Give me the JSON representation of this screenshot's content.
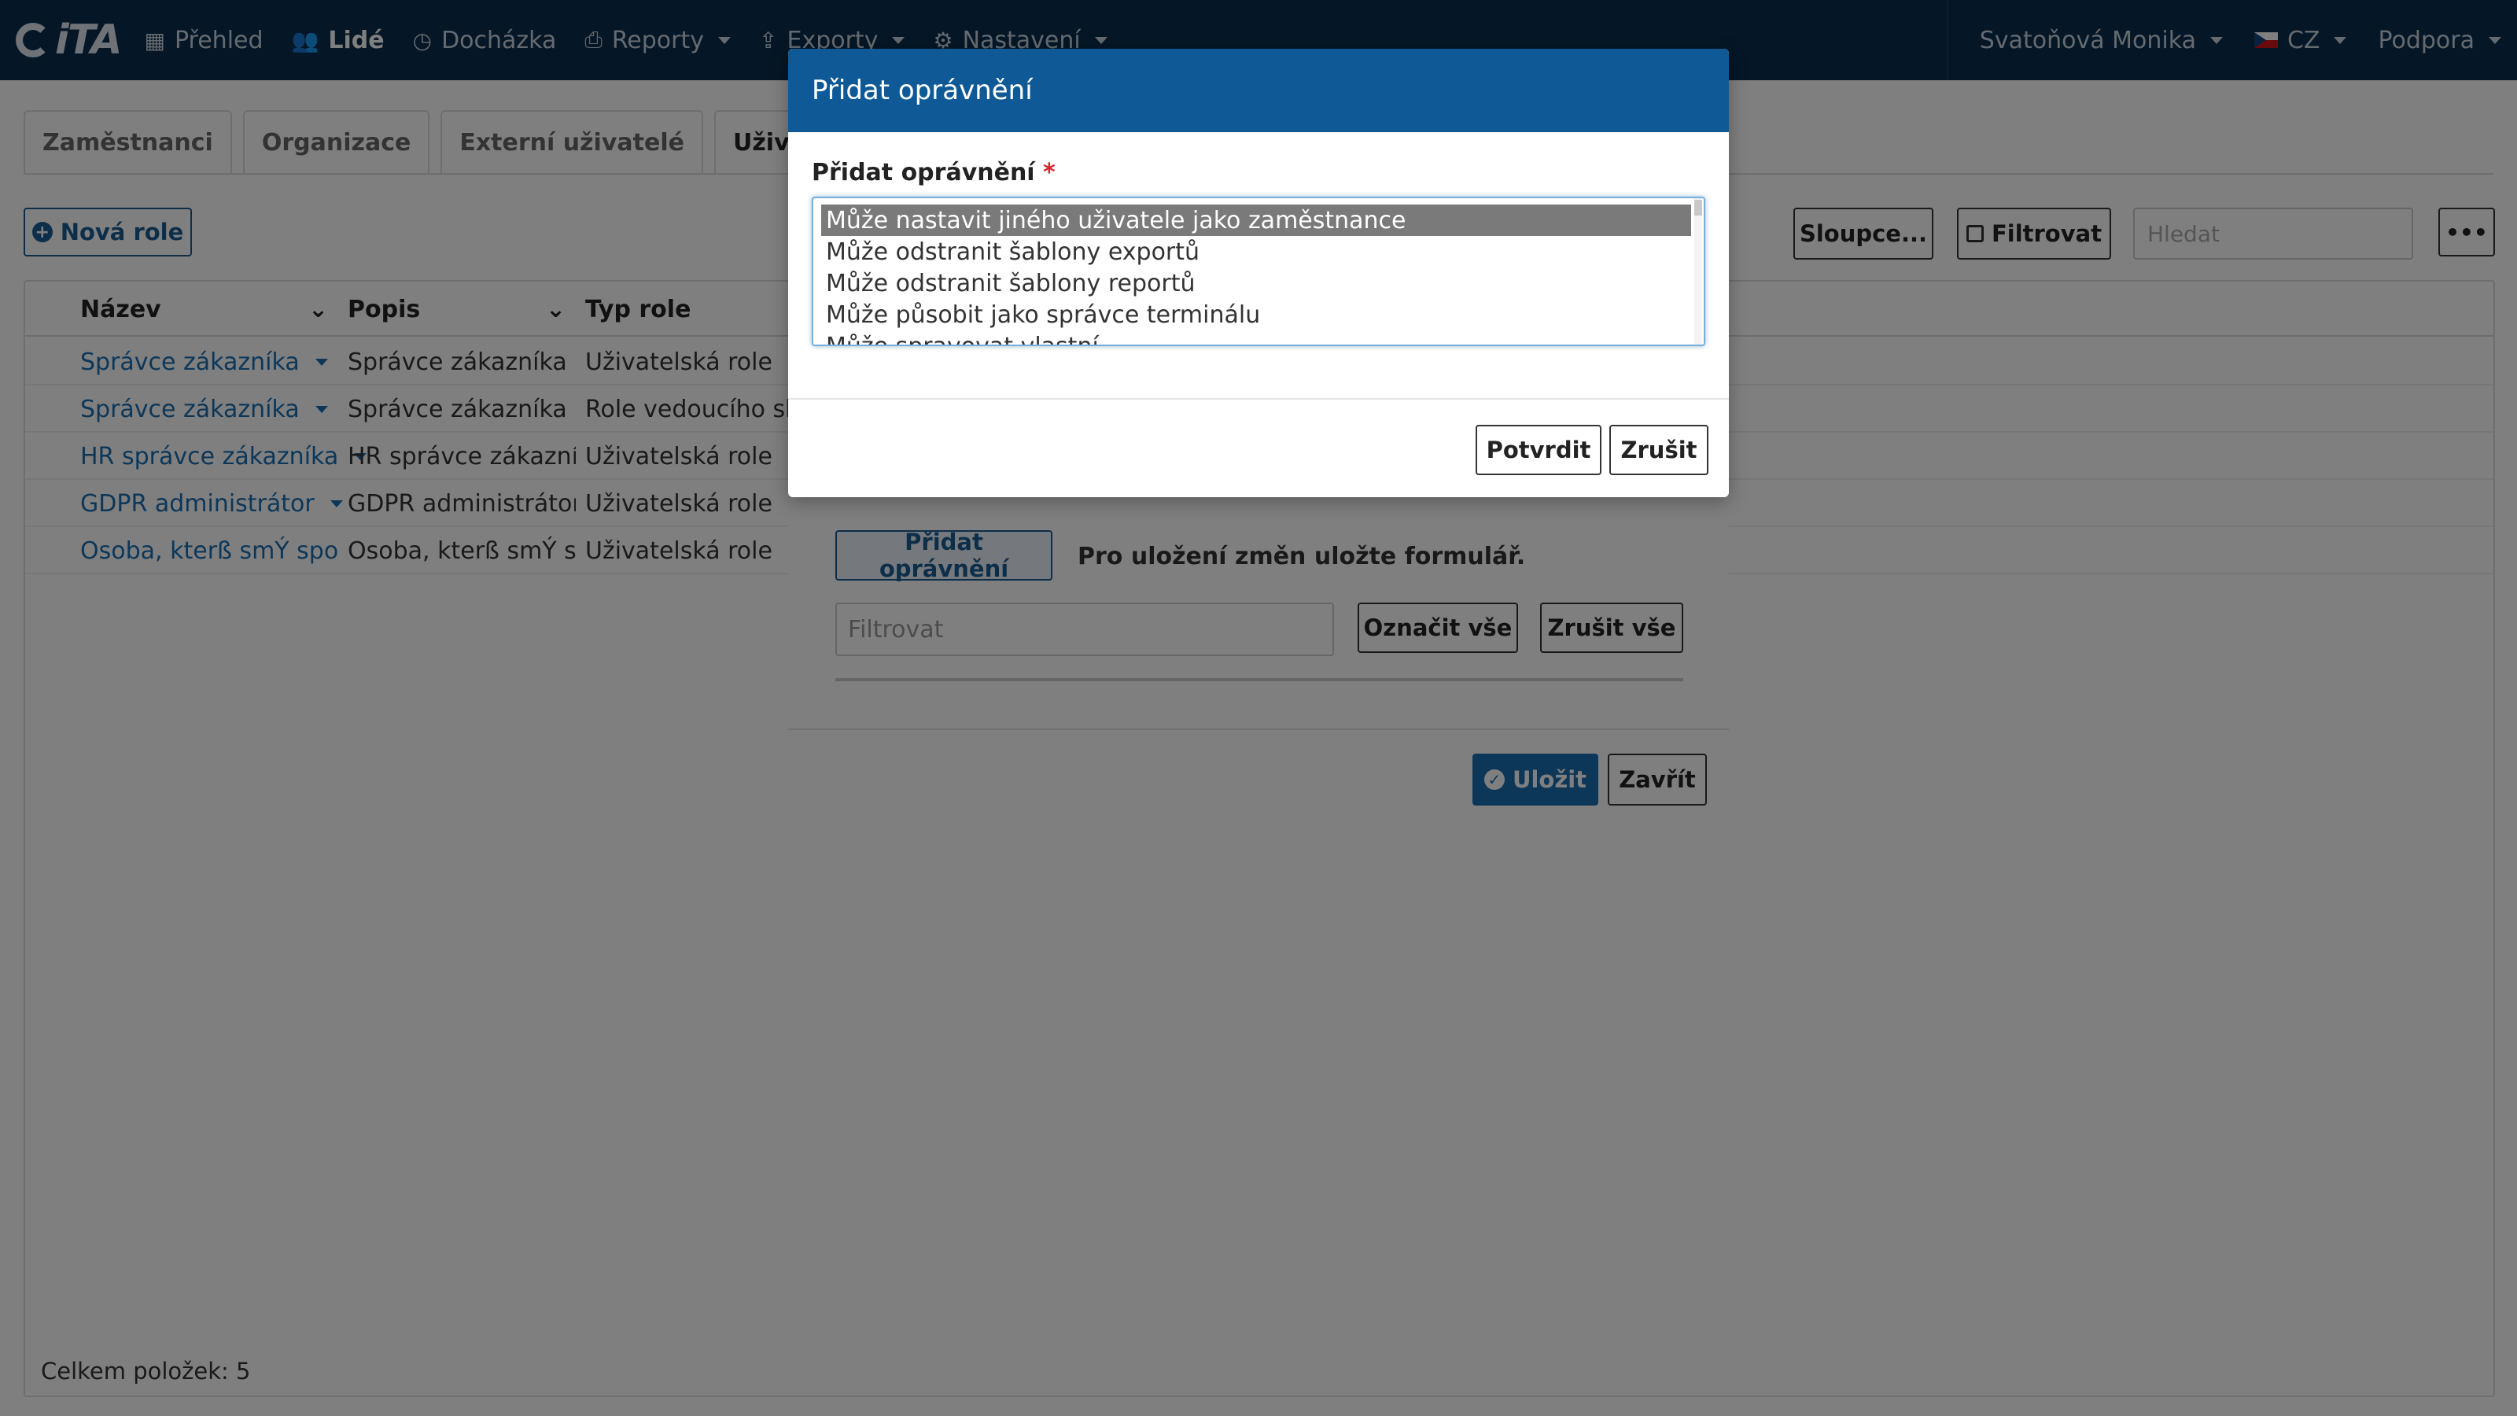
{
  "navbar": {
    "logo_text": "iTA",
    "items": [
      {
        "label": "Přehled",
        "icon": "grid-icon"
      },
      {
        "label": "Lidé",
        "icon": "users-icon"
      },
      {
        "label": "Docházka",
        "icon": "clock-icon"
      },
      {
        "label": "Reporty",
        "icon": "printer-icon"
      },
      {
        "label": "Exporty",
        "icon": "export-icon"
      },
      {
        "label": "Nastavení",
        "icon": "gear-icon"
      }
    ],
    "user": "Svatoňová Monika",
    "language": "CZ",
    "support": "Podpora"
  },
  "tabs": [
    "Zaměstnanci",
    "Organizace",
    "Externí uživatelé",
    "Uživatelské r"
  ],
  "toolbar": {
    "new_role": "Nová role",
    "columns": "Sloupce...",
    "filter": "Filtrovat",
    "search_placeholder": "Hledat",
    "more": "•••"
  },
  "table": {
    "headers": [
      "Název",
      "Popis",
      "Typ role"
    ],
    "rows": [
      {
        "name": "Správce zákazníka",
        "desc": "Správce zákazníka",
        "type": "Uživatelská role"
      },
      {
        "name": "Správce zákazníka",
        "desc": "Správce zákazníka",
        "type": "Role vedoucího sku"
      },
      {
        "name": "HR správce zákazníka",
        "desc": "HR správce zákazníka",
        "type": "Uživatelská role"
      },
      {
        "name": "GDPR administrátor",
        "desc": "GDPR administrátor",
        "type": "Uživatelská role"
      },
      {
        "name": "Osoba, kterß smÝ spo...",
        "desc": "Osoba, kterß smÝ s...",
        "type": "Uživatelská role"
      }
    ],
    "total": "Celkem položek: 5"
  },
  "edit_dialog": {
    "add_permission": "Přidat oprávnění",
    "hint": "Pro uložení změn uložte formulář.",
    "filter_placeholder": "Filtrovat",
    "mark_all": "Označit vše",
    "unmark_all": "Zrušit vše",
    "save": "Uložit",
    "close": "Zavřít"
  },
  "modal": {
    "title": "Přidat oprávnění",
    "field_label": "Přidat oprávnění",
    "required_mark": "*",
    "options": [
      "Může nastavit jiného uživatele jako zaměstnance",
      "Může odstranit šablony exportů",
      "Může odstranit šablony reportů",
      "Může působit jako správce terminálu",
      "Může spravovat vlastní"
    ],
    "selected_index": 0,
    "confirm": "Potvrdit",
    "cancel": "Zrušit"
  }
}
